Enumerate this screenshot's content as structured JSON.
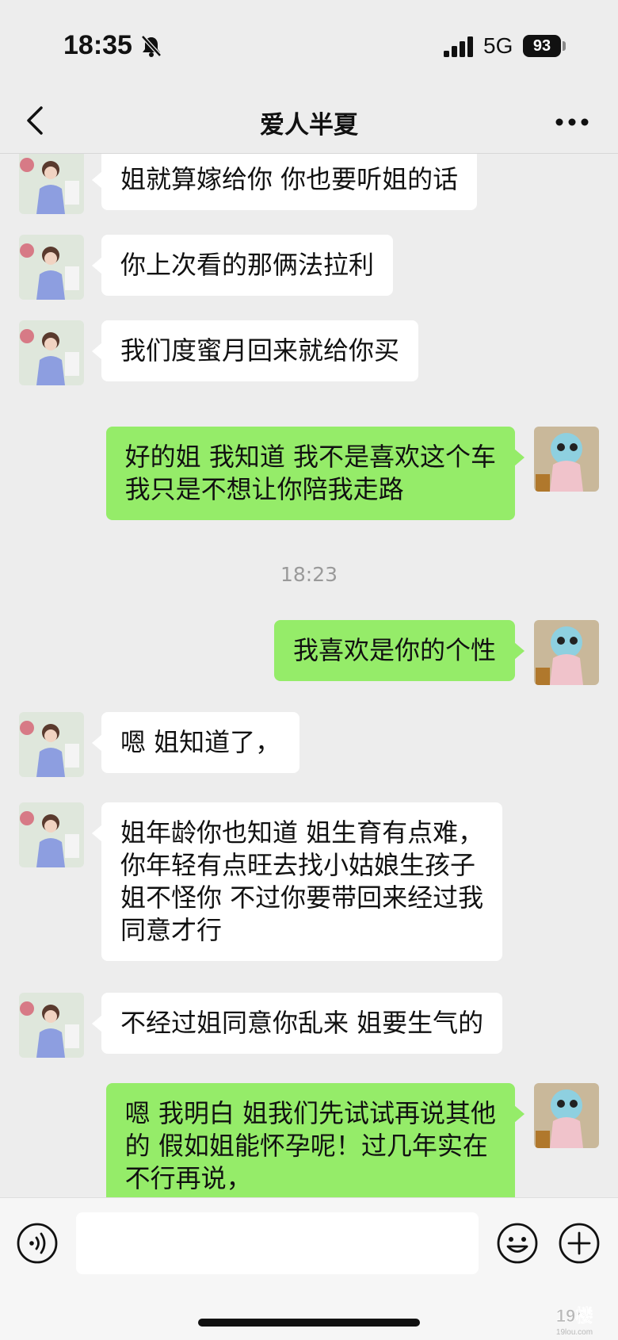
{
  "status_bar": {
    "time": "18:35",
    "network": "5G",
    "battery": "93"
  },
  "nav": {
    "title": "爱人半夏"
  },
  "chat": {
    "messages": [
      {
        "from": "them",
        "text": "姐就算嫁给你 你也要听姐的话"
      },
      {
        "from": "them",
        "text": "你上次看的那俩法拉利"
      },
      {
        "from": "them",
        "text": "我们度蜜月回来就给你买"
      },
      {
        "from": "me",
        "text": "好的姐  我知道 我不是喜欢这个车\n我只是不想让你陪我走路"
      },
      {
        "from": "time",
        "text": "18:23"
      },
      {
        "from": "me",
        "text": "我喜欢是你的个性"
      },
      {
        "from": "them",
        "text": "嗯 姐知道了，"
      },
      {
        "from": "them",
        "text": "姐年龄你也知道 姐生育有点难，\n你年轻有点旺去找小姑娘生孩子\n姐不怪你 不过你要带回来经过我\n同意才行"
      },
      {
        "from": "them",
        "text": "不经过姐同意你乱来  姐要生气的"
      },
      {
        "from": "me",
        "text": "嗯 我明白  姐我们先试试再说其他\n的 假如姐能怀孕呢！过几年实在\n不行再说，"
      }
    ]
  },
  "input_bar": {
    "value": "",
    "placeholder": ""
  },
  "watermark": {
    "text": "19楼",
    "sub": "19lou.com"
  },
  "icons": {
    "bell": "bell-muted-icon",
    "back": "chevron-left-icon",
    "more": "more-dots-icon",
    "voice": "voice-icon",
    "emoji": "emoji-icon",
    "plus": "plus-icon"
  },
  "colors": {
    "background": "#ededed",
    "incoming_bubble": "#ffffff",
    "outgoing_bubble": "#95ec69"
  }
}
